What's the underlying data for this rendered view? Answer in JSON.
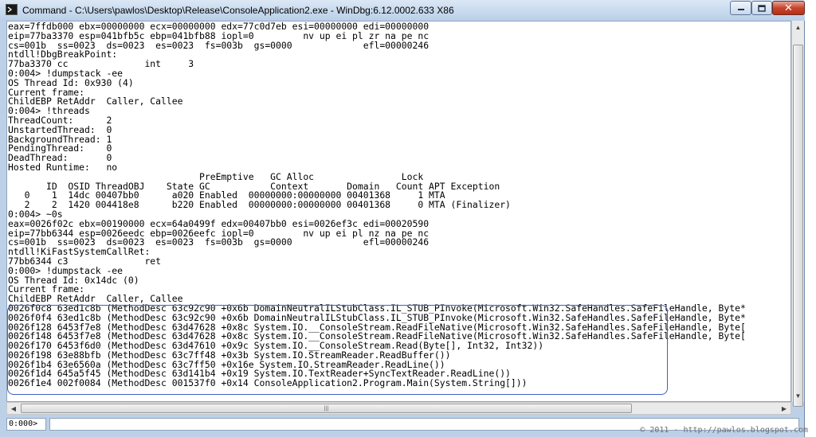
{
  "window": {
    "title": "Command - C:\\Users\\pawlos\\Desktop\\Release\\ConsoleApplication2.exe - WinDbg:6.12.0002.633 X86",
    "icon": "console-icon",
    "controls": {
      "minimize": "minimize-icon",
      "maximize": "maximize-icon",
      "close": "close-icon"
    }
  },
  "output": {
    "lines": [
      "eax=7ffdb000 ebx=00000000 ecx=00000000 edx=77c0d7eb esi=00000000 edi=00000000",
      "eip=77ba3370 esp=041bfb5c ebp=041bfb88 iopl=0         nv up ei pl zr na pe nc",
      "cs=001b  ss=0023  ds=0023  es=0023  fs=003b  gs=0000             efl=00000246",
      "ntdll!DbgBreakPoint:",
      "77ba3370 cc              int     3",
      "0:004> !dumpstack -ee",
      "OS Thread Id: 0x930 (4)",
      "Current frame:",
      "ChildEBP RetAddr  Caller, Callee",
      "0:004> !threads",
      "ThreadCount:      2",
      "UnstartedThread:  0",
      "BackgroundThread: 1",
      "PendingThread:    0",
      "DeadThread:       0",
      "Hosted Runtime:   no",
      "                                   PreEmptive   GC Alloc                Lock",
      "       ID  OSID ThreadOBJ    State GC           Context       Domain   Count APT Exception",
      "   0    1  14dc 00407bb0      a020 Enabled  00000000:00000000 00401368     1 MTA",
      "   2    2  1420 004418e8      b220 Enabled  00000000:00000000 00401368     0 MTA (Finalizer)",
      "0:004> ~0s",
      "eax=0026f02c ebx=00190000 ecx=64a0499f edx=00407bb0 esi=0026ef3c edi=00020590",
      "eip=77bb6344 esp=0026eedc ebp=0026eefc iopl=0         nv up ei pl nz na pe nc",
      "cs=001b  ss=0023  ds=0023  es=0023  fs=003b  gs=0000             efl=00000246",
      "ntdll!KiFastSystemCallRet:",
      "77bb6344 c3              ret",
      "0:000> !dumpstack -ee",
      "OS Thread Id: 0x14dc (0)",
      "Current frame:",
      "ChildEBP RetAddr  Caller, Callee",
      "0026f0c8 63ed1c8b (MethodDesc 63c92c90 +0x6b DomainNeutralILStubClass.IL_STUB_PInvoke(Microsoft.Win32.SafeHandles.SafeFileHandle, Byte*",
      "0026f0f4 63ed1c8b (MethodDesc 63c92c90 +0x6b DomainNeutralILStubClass.IL_STUB_PInvoke(Microsoft.Win32.SafeHandles.SafeFileHandle, Byte*",
      "0026f128 6453f7e8 (MethodDesc 63d47628 +0x8c System.IO.__ConsoleStream.ReadFileNative(Microsoft.Win32.SafeHandles.SafeFileHandle, Byte[",
      "0026f148 6453f7e8 (MethodDesc 63d47628 +0x8c System.IO.__ConsoleStream.ReadFileNative(Microsoft.Win32.SafeHandles.SafeFileHandle, Byte[",
      "0026f170 6453f6d0 (MethodDesc 63d47610 +0x9c System.IO.__ConsoleStream.Read(Byte[], Int32, Int32))",
      "0026f198 63e88bfb (MethodDesc 63c7ff48 +0x3b System.IO.StreamReader.ReadBuffer())",
      "0026f1b4 63e6560a (MethodDesc 63c7ff50 +0x16e System.IO.StreamReader.ReadLine())",
      "0026f1d4 645a5f45 (MethodDesc 63d141b4 +0x19 System.IO.TextReader+SyncTextReader.ReadLine())",
      "0026f1e4 002f0084 (MethodDesc 001537f0 +0x14 ConsoleApplication2.Program.Main(System.String[]))"
    ]
  },
  "command": {
    "prompt": "0:000>",
    "value": ""
  },
  "watermark": "© 2011 - http://pawlos.blogspot.com",
  "colors": {
    "highlight": "#3f5fc8",
    "chrome": "#bcd1e8",
    "close_button": "#c7452d"
  }
}
